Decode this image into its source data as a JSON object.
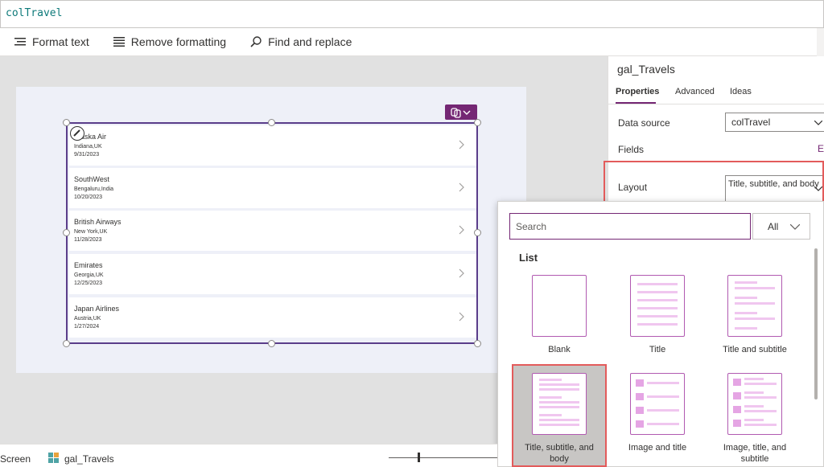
{
  "formula": {
    "value": "colTravel"
  },
  "toolbar": {
    "format_text": "Format text",
    "remove_formatting": "Remove formatting",
    "find_replace": "Find and replace"
  },
  "gallery": {
    "rows": [
      {
        "title": "Alaska Air",
        "subtitle": "Indiana,UK",
        "body": "9/31/2023"
      },
      {
        "title": "SouthWest",
        "subtitle": "Bengaluru,India",
        "body": "10/20/2023"
      },
      {
        "title": "British Airways",
        "subtitle": "New York,UK",
        "body": "11/28/2023"
      },
      {
        "title": "Emirates",
        "subtitle": "Georgia,UK",
        "body": "12/25/2023"
      },
      {
        "title": "Japan Airlines",
        "subtitle": "Austria,UK",
        "body": "1/27/2024"
      }
    ]
  },
  "panel": {
    "title": "gal_Travels",
    "tabs": [
      "Properties",
      "Advanced",
      "Ideas"
    ],
    "data_source_label": "Data source",
    "data_source_value": "colTravel",
    "fields_label": "Fields",
    "fields_edit": "Ed",
    "layout_label": "Layout",
    "layout_value": "Title, subtitle, and body"
  },
  "layout_dropdown": {
    "search_placeholder": "Search",
    "filter_value": "All",
    "section_title": "List",
    "tiles": [
      "Blank",
      "Title",
      "Title and subtitle",
      "Title, subtitle, and body",
      "Image and title",
      "Image, title, and subtitle"
    ],
    "selected": "Title, subtitle, and body"
  },
  "statusbar": {
    "screen_label": "Screen",
    "control_label": "gal_Travels"
  },
  "colors": {
    "accent": "#742774",
    "highlight": "#e35b5b",
    "gallery_border": "#5a3d8a"
  }
}
